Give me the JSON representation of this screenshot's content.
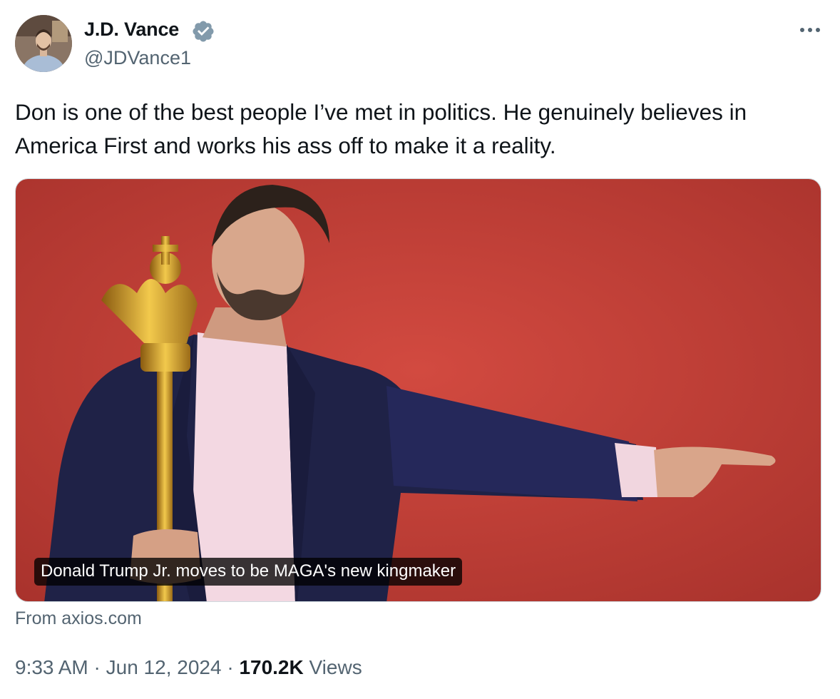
{
  "author": {
    "name": "J.D. Vance",
    "handle": "@JDVance1",
    "verified": true,
    "avatar_icon": "avatar-photo"
  },
  "tweet": {
    "text": "Don is one of the best people I’ve met in politics. He genuinely believes in America First and works his ass off to make it a reality."
  },
  "card": {
    "title": "Donald Trump Jr. moves to be MAGA's new kingmaker",
    "source": "From axios.com",
    "background_color": "#c8413a"
  },
  "meta": {
    "time": "9:33 AM",
    "separator": "·",
    "date": "Jun 12, 2024",
    "views_count": "170.2K",
    "views_label": "Views"
  },
  "colors": {
    "text_primary": "#0f1419",
    "text_secondary": "#536471",
    "verified_blue": "#829aab",
    "border": "#cfd9de"
  }
}
